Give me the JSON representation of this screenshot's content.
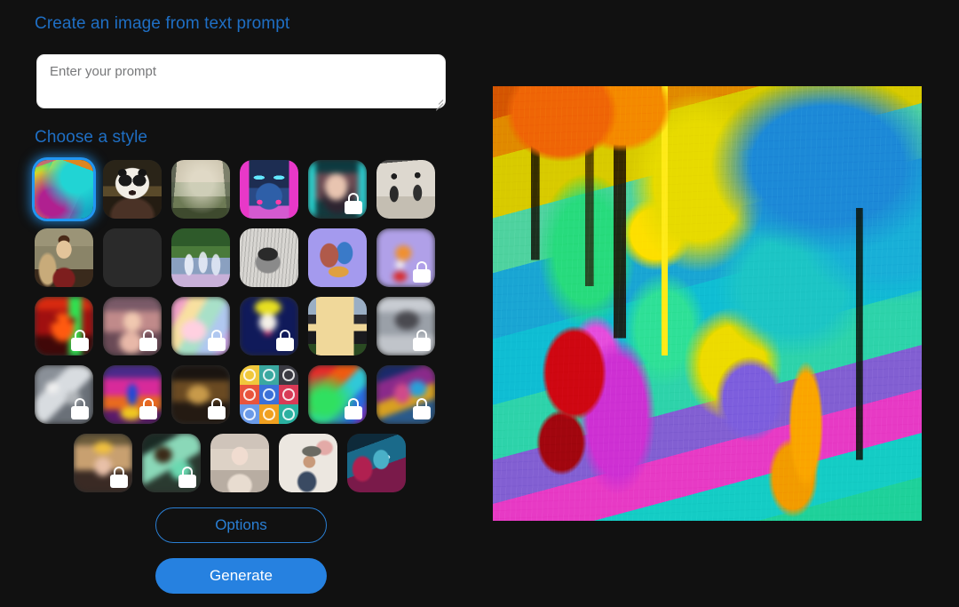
{
  "app": {
    "background_color": "#111111",
    "accent_color": "#2681e0",
    "heading_color": "#1f6fc4"
  },
  "headings": {
    "create": "Create an image from text prompt",
    "choose_style": "Choose a style"
  },
  "prompt": {
    "value": "",
    "placeholder": "Enter your prompt"
  },
  "buttons": {
    "options": "Options",
    "generate": "Generate"
  },
  "style_grid": {
    "rows": [
      [
        {
          "name": "abstract-paint",
          "locked": false,
          "selected": true
        },
        {
          "name": "panda-render",
          "locked": false,
          "selected": false
        },
        {
          "name": "misty-landscape",
          "locked": false,
          "selected": false
        },
        {
          "name": "cyber-robot",
          "locked": false,
          "selected": false
        },
        {
          "name": "portrait-neon",
          "locked": true,
          "selected": false
        },
        {
          "name": "vintage-engraving",
          "locked": false,
          "selected": false
        }
      ],
      [
        {
          "name": "renaissance-portrait",
          "locked": false,
          "selected": false
        },
        {
          "name": "folk-flowers",
          "locked": false,
          "selected": false
        },
        {
          "name": "impressionist-ballet",
          "locked": false,
          "selected": false
        },
        {
          "name": "pencil-sketch-cup",
          "locked": false,
          "selected": false
        },
        {
          "name": "isometric-desk",
          "locked": false,
          "selected": false
        },
        {
          "name": "fox-soft",
          "locked": true,
          "selected": false
        }
      ],
      [
        {
          "name": "thermal-face",
          "locked": true,
          "selected": false
        },
        {
          "name": "pastel-portrait",
          "locked": true,
          "selected": false
        },
        {
          "name": "rainbow-dream",
          "locked": true,
          "selected": false
        },
        {
          "name": "pop-art-icon",
          "locked": true,
          "selected": false
        },
        {
          "name": "modern-architecture",
          "locked": false,
          "selected": false
        },
        {
          "name": "grey-cloud",
          "locked": true,
          "selected": false
        }
      ],
      [
        {
          "name": "metal-debris",
          "locked": true,
          "selected": false
        },
        {
          "name": "neon-figure",
          "locked": true,
          "selected": false
        },
        {
          "name": "sepia-blur",
          "locked": true,
          "selected": false
        },
        {
          "name": "icon-set-grid",
          "locked": false,
          "selected": false
        },
        {
          "name": "vivid-swirl",
          "locked": true,
          "selected": false
        },
        {
          "name": "chromatic-portrait",
          "locked": true,
          "selected": false
        }
      ],
      [
        {
          "name": "golden-crown-face",
          "locked": true,
          "selected": false
        },
        {
          "name": "green-mist",
          "locked": true,
          "selected": false
        },
        {
          "name": "doll-portrait",
          "locked": false,
          "selected": false
        },
        {
          "name": "watercolor-soldier",
          "locked": false,
          "selected": false
        },
        {
          "name": "teal-fantasy-face",
          "locked": false,
          "selected": false
        }
      ]
    ]
  },
  "result": {
    "alt": "Generated abstract painting with flowing orange, yellow, green, teal, magenta and blue strokes"
  }
}
